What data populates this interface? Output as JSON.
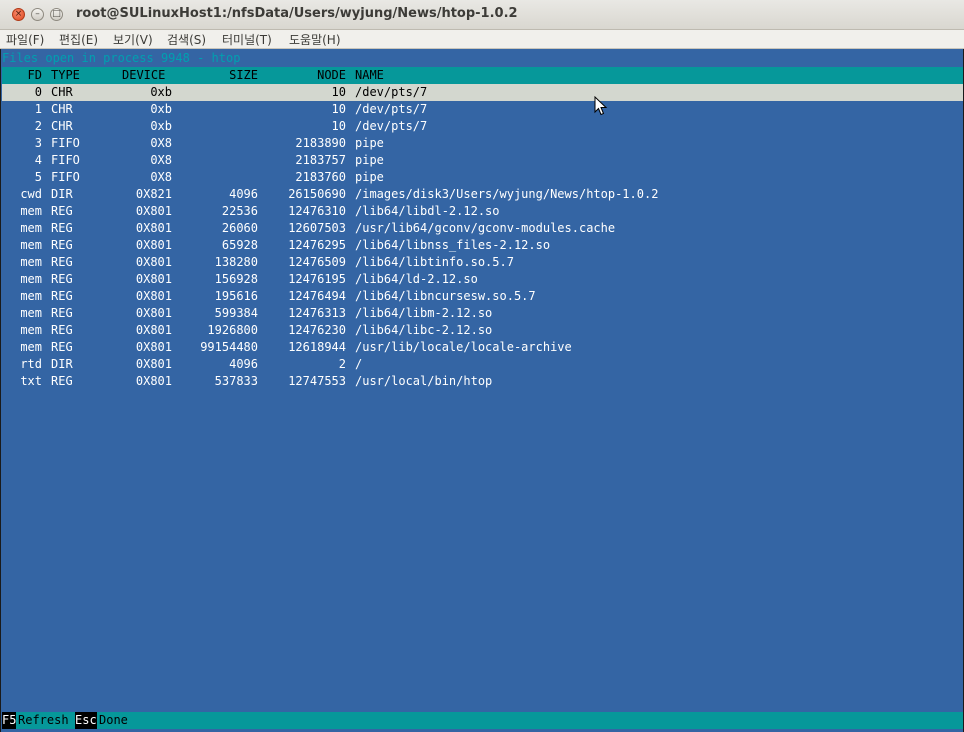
{
  "window": {
    "title": "root@SULinuxHost1:/nfsData/Users/wyjung/News/htop-1.0.2",
    "close_glyph": "×",
    "min_glyph": "–",
    "max_glyph": "□"
  },
  "menubar": {
    "items": [
      {
        "label": "파일(F)"
      },
      {
        "label": "편집(E)"
      },
      {
        "label": "보기(V)"
      },
      {
        "label": "검색(S)"
      },
      {
        "label": "터미널(T)"
      },
      {
        "label": "도움말(H)"
      }
    ]
  },
  "terminal": {
    "header": "Files open in process 9948 - htop",
    "columns": {
      "fd": "FD",
      "type": "TYPE",
      "device": "DEVICE",
      "size": "SIZE",
      "node": "NODE",
      "name": "NAME"
    },
    "rows": [
      {
        "fd": "0",
        "type": "CHR",
        "device": "0xb",
        "size": "",
        "node": "10",
        "name": "/dev/pts/7"
      },
      {
        "fd": "1",
        "type": "CHR",
        "device": "0xb",
        "size": "",
        "node": "10",
        "name": "/dev/pts/7"
      },
      {
        "fd": "2",
        "type": "CHR",
        "device": "0xb",
        "size": "",
        "node": "10",
        "name": "/dev/pts/7"
      },
      {
        "fd": "3",
        "type": "FIFO",
        "device": "0X8",
        "size": "",
        "node": "2183890",
        "name": "pipe"
      },
      {
        "fd": "4",
        "type": "FIFO",
        "device": "0X8",
        "size": "",
        "node": "2183757",
        "name": "pipe"
      },
      {
        "fd": "5",
        "type": "FIFO",
        "device": "0X8",
        "size": "",
        "node": "2183760",
        "name": "pipe"
      },
      {
        "fd": "cwd",
        "type": "DIR",
        "device": "0X821",
        "size": "4096",
        "node": "26150690",
        "name": "/images/disk3/Users/wyjung/News/htop-1.0.2"
      },
      {
        "fd": "mem",
        "type": "REG",
        "device": "0X801",
        "size": "22536",
        "node": "12476310",
        "name": "/lib64/libdl-2.12.so"
      },
      {
        "fd": "mem",
        "type": "REG",
        "device": "0X801",
        "size": "26060",
        "node": "12607503",
        "name": "/usr/lib64/gconv/gconv-modules.cache"
      },
      {
        "fd": "mem",
        "type": "REG",
        "device": "0X801",
        "size": "65928",
        "node": "12476295",
        "name": "/lib64/libnss_files-2.12.so"
      },
      {
        "fd": "mem",
        "type": "REG",
        "device": "0X801",
        "size": "138280",
        "node": "12476509",
        "name": "/lib64/libtinfo.so.5.7"
      },
      {
        "fd": "mem",
        "type": "REG",
        "device": "0X801",
        "size": "156928",
        "node": "12476195",
        "name": "/lib64/ld-2.12.so"
      },
      {
        "fd": "mem",
        "type": "REG",
        "device": "0X801",
        "size": "195616",
        "node": "12476494",
        "name": "/lib64/libncursesw.so.5.7"
      },
      {
        "fd": "mem",
        "type": "REG",
        "device": "0X801",
        "size": "599384",
        "node": "12476313",
        "name": "/lib64/libm-2.12.so"
      },
      {
        "fd": "mem",
        "type": "REG",
        "device": "0X801",
        "size": "1926800",
        "node": "12476230",
        "name": "/lib64/libc-2.12.so"
      },
      {
        "fd": "mem",
        "type": "REG",
        "device": "0X801",
        "size": "99154480",
        "node": "12618944",
        "name": "/usr/lib/locale/locale-archive"
      },
      {
        "fd": "rtd",
        "type": "DIR",
        "device": "0X801",
        "size": "4096",
        "node": "2",
        "name": "/"
      },
      {
        "fd": "txt",
        "type": "REG",
        "device": "0X801",
        "size": "537833",
        "node": "12747553",
        "name": "/usr/local/bin/htop"
      }
    ]
  },
  "footer": {
    "keys": [
      {
        "key": "F5",
        "label": "Refresh"
      },
      {
        "key": "Esc",
        "label": "Done"
      }
    ]
  },
  "colors": {
    "terminal_bg": "#3465a4",
    "header_bar": "#06989a",
    "selection": "#d3d7cf"
  }
}
